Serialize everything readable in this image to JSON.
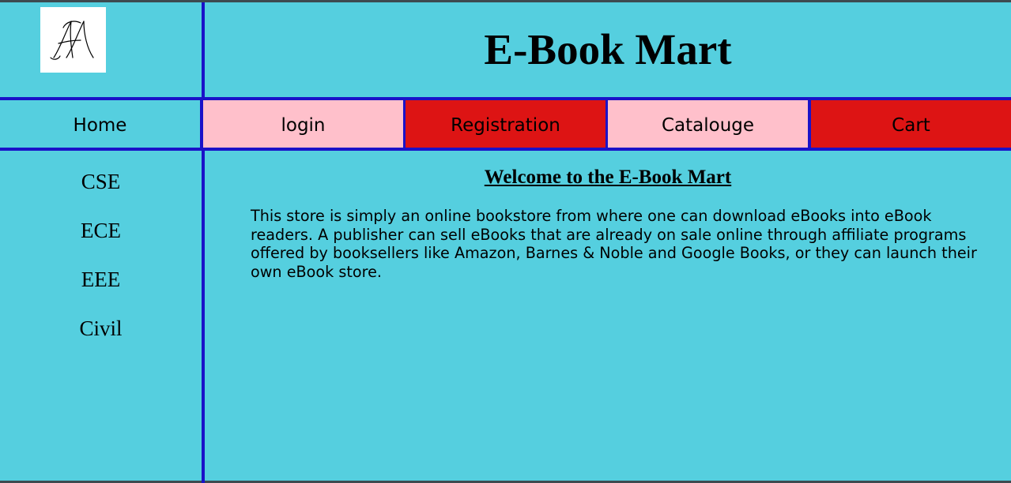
{
  "header": {
    "logo_text": "AA",
    "title": "E-Book Mart"
  },
  "nav": {
    "items": [
      {
        "label": "Home",
        "color": "#55cfdf"
      },
      {
        "label": "login",
        "color": "#ffc0cb"
      },
      {
        "label": "Registration",
        "color": "#dd1414"
      },
      {
        "label": "Catalouge",
        "color": "#ffc0cb"
      },
      {
        "label": "Cart",
        "color": "#dd1414"
      }
    ]
  },
  "sidebar": {
    "items": [
      {
        "label": "CSE"
      },
      {
        "label": "ECE"
      },
      {
        "label": "EEE"
      },
      {
        "label": "Civil"
      }
    ]
  },
  "main": {
    "heading": "Welcome to the E-Book Mart",
    "paragraph": "This store is simply an online bookstore from where one can download eBooks into eBook readers. A publisher can sell eBooks that are already on sale online through affiliate programs offered by booksellers like Amazon, Barnes & Noble and Google Books, or they can launch their own eBook store."
  },
  "colors": {
    "background": "#55cfdf",
    "divider": "#1a12c8",
    "pink": "#ffc0cb",
    "red": "#dd1414"
  }
}
